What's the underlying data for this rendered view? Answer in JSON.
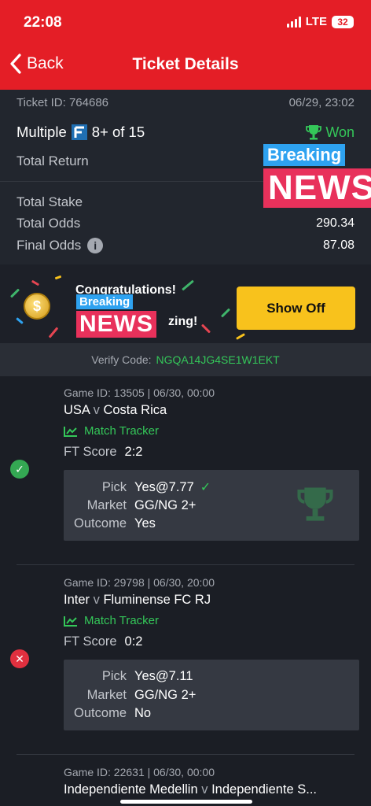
{
  "status_bar": {
    "time": "22:08",
    "network": "LTE",
    "battery": "32"
  },
  "nav": {
    "back_label": "Back",
    "title": "Ticket Details"
  },
  "ticket": {
    "id_label": "Ticket ID: 764686",
    "datetime": "06/29, 23:02",
    "type": "Multiple",
    "selection": "8+ of 15",
    "status": "Won",
    "total_return_label": "Total Return",
    "total_stake_label": "Total Stake",
    "total_odds_label": "Total Odds",
    "total_odds": "290.34",
    "final_odds_label": "Final Odds",
    "final_odds": "87.08"
  },
  "overlay": {
    "breaking": "Breaking",
    "news": "NEWS"
  },
  "promo": {
    "congrats": "Congratulations!",
    "amazing_tail": "zing!",
    "coin_symbol": "$",
    "show_off": "Show Off"
  },
  "verify": {
    "label": "Verify Code:",
    "code": "NGQA14JG4SE1W1EKT"
  },
  "games": [
    {
      "id_line": "Game ID: 13505 | 06/30, 00:00",
      "home": "USA",
      "vs": "v",
      "away": "Costa Rica",
      "tracker": "Match Tracker",
      "ft_label": "FT Score",
      "ft_score": "2:2",
      "pick_label": "Pick",
      "pick": "Yes@7.77",
      "market_label": "Market",
      "market": "GG/NG 2+",
      "outcome_label": "Outcome",
      "outcome": "Yes",
      "result": "won"
    },
    {
      "id_line": "Game ID: 29798 | 06/30, 20:00",
      "home": "Inter",
      "vs": "v",
      "away": "Fluminense FC RJ",
      "tracker": "Match Tracker",
      "ft_label": "FT Score",
      "ft_score": "0:2",
      "pick_label": "Pick",
      "pick": "Yes@7.11",
      "market_label": "Market",
      "market": "GG/NG 2+",
      "outcome_label": "Outcome",
      "outcome": "No",
      "result": "lost"
    },
    {
      "id_line": "Game ID: 22631 | 06/30, 00:00",
      "home": "Independiente Medellin",
      "vs": "v",
      "away": "Independiente S..."
    }
  ],
  "colors": {
    "brand_red": "#e41e26",
    "win_green": "#34c759",
    "loss_red": "#e0303f",
    "gold": "#f8c21c"
  }
}
